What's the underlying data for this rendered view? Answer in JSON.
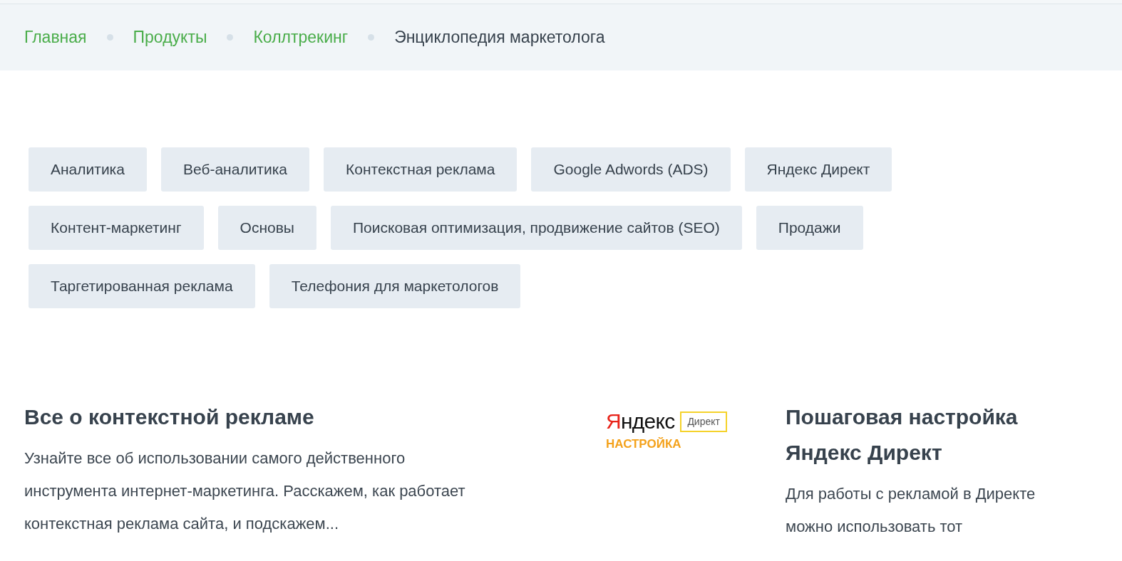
{
  "breadcrumbs": [
    {
      "label": "Главная",
      "current": false
    },
    {
      "label": "Продукты",
      "current": false
    },
    {
      "label": "Коллтрекинг",
      "current": false
    },
    {
      "label": "Энциклопедия маркетолога",
      "current": true
    }
  ],
  "tags": [
    "Аналитика",
    "Веб-аналитика",
    "Контекстная реклама",
    "Google Adwords (ADS)",
    "Яндекс Директ",
    "Контент-маркетинг",
    "Основы",
    "Поисковая оптимизация, продвижение сайтов (SEO)",
    "Продажи",
    "Таргетированная реклама",
    "Телефония для маркетологов"
  ],
  "articles": [
    {
      "kind": "text",
      "title": "Все о контекстной рекламе",
      "excerpt": "Узнайте все об использовании самого действенного инструмента интернет-маркетинга. Расскажем, как работает контекстная реклама сайта, и подскажем..."
    },
    {
      "kind": "logo",
      "brand": "Яндекс",
      "product": "Директ",
      "caption": "НАСТРОЙКА"
    },
    {
      "kind": "text",
      "title": "Пошаговая настройка Яндекс Директ",
      "excerpt": "Для работы с рекламой в Директе можно использовать тот"
    }
  ]
}
